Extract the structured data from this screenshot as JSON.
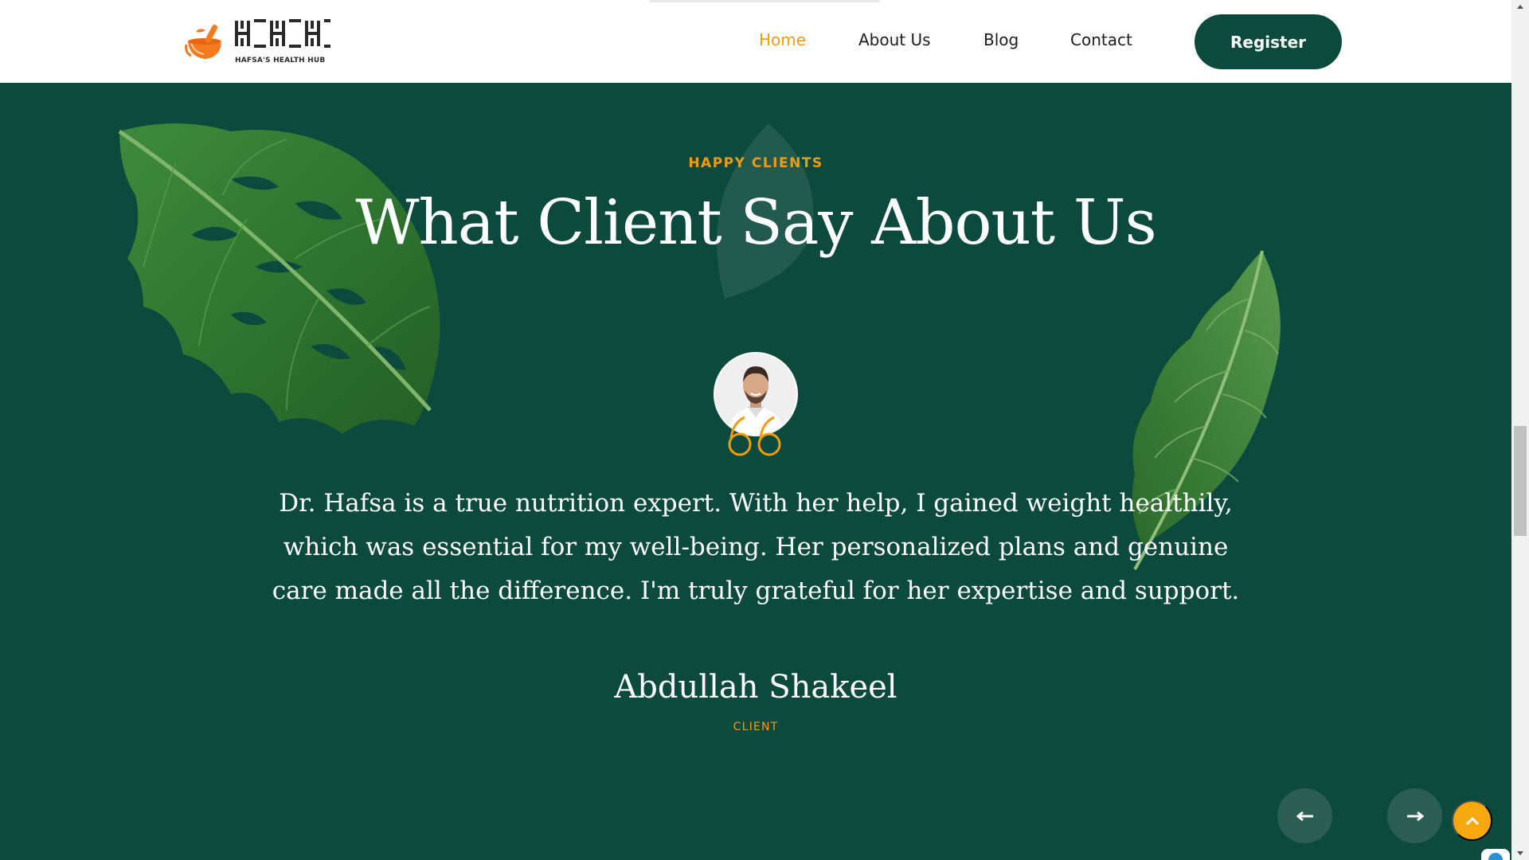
{
  "brand": {
    "logo_letters": "HHH",
    "tagline": "HAFSA'S HEALTH HUB",
    "logo_icon": "mortar-pestle-icon",
    "accent_color": "#f29c0c",
    "primary_color": "#0c4a3e"
  },
  "nav": {
    "items": [
      {
        "label": "Home",
        "active": true
      },
      {
        "label": "About Us",
        "active": false
      },
      {
        "label": "Blog",
        "active": false
      },
      {
        "label": "Contact",
        "active": false
      }
    ],
    "register_label": "Register"
  },
  "testimonials": {
    "eyebrow": "HAPPY CLIENTS",
    "heading": "What Client Say About Us",
    "quote": "Dr. Hafsa is a true nutrition expert. With her help, I gained weight healthily, which was essential for my well-being. Her personalized plans and genuine care made all the difference. I'm truly grateful for her expertise and support.",
    "client_name": "Abdullah Shakeel",
    "client_role": "CLIENT",
    "prev_icon": "arrow-left-icon",
    "next_icon": "arrow-right-icon"
  },
  "back_to_top_icon": "chevron-up-icon"
}
